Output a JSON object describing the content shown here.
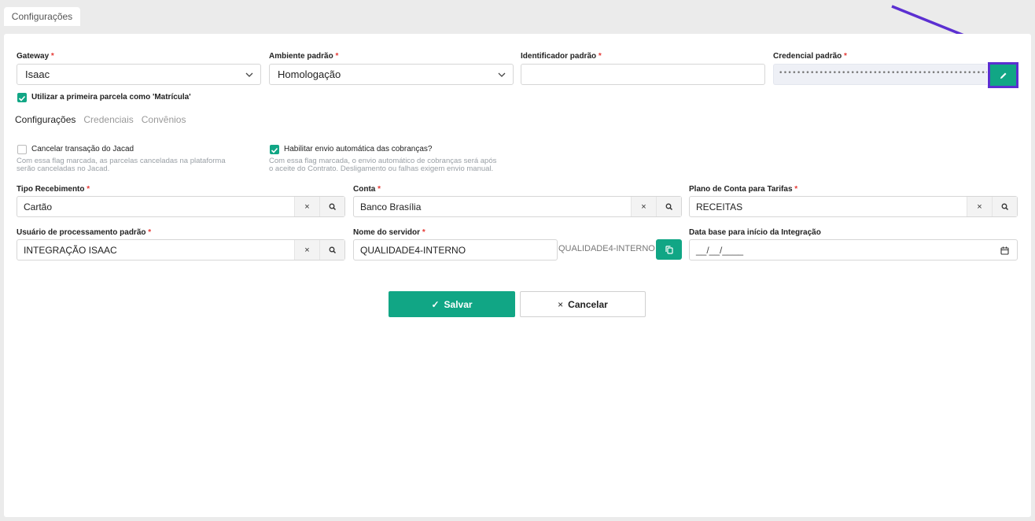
{
  "page_tab": "Configurações",
  "gateway": {
    "label": "Gateway",
    "value": "Isaac"
  },
  "ambiente": {
    "label": "Ambiente padrão",
    "value": "Homologação"
  },
  "identificador": {
    "label": "Identificador padrão",
    "value": ""
  },
  "credencial": {
    "label": "Credencial padrão",
    "masked": "••••••••••••••••••••••••••••••••••••••••••••••••••••••••••••••••••••"
  },
  "required_mark": "*",
  "primeira_parcela": {
    "label": "Utilizar a primeira parcela como 'Matrícula'",
    "checked": true
  },
  "tabs": [
    {
      "label": "Configurações",
      "active": true
    },
    {
      "label": "Credenciais",
      "active": false
    },
    {
      "label": "Convênios",
      "active": false
    }
  ],
  "cancelar_transacao": {
    "label": "Cancelar transação do Jacad",
    "checked": false,
    "hint_line1": "Com essa flag marcada, as parcelas canceladas na plataforma",
    "hint_line2": "serão canceladas no Jacad."
  },
  "habilitar_envio": {
    "label": "Habilitar envio automática das cobranças?",
    "checked": true,
    "hint_line1": "Com essa flag marcada, o envio automático de cobranças será após",
    "hint_line2": "o aceite do Contrato. Desligamento ou falhas exigem envio manual."
  },
  "tipo_recebimento": {
    "label": "Tipo Recebimento",
    "value": "Cartão"
  },
  "conta": {
    "label": "Conta",
    "value": "Banco Brasília"
  },
  "plano_conta": {
    "label": "Plano de Conta para Tarifas",
    "value": "RECEITAS"
  },
  "usuario_processamento": {
    "label": "Usuário de processamento padrão",
    "value": "INTEGRAÇÃO ISAAC"
  },
  "nome_servidor": {
    "label": "Nome do servidor",
    "value": "QUALIDADE4-INTERNO",
    "display": "QUALIDADE4-INTERNO"
  },
  "data_base": {
    "label": "Data base para início da Integração",
    "placeholder": "__/__/____"
  },
  "icons": {
    "clear": "×",
    "search": "search-icon"
  },
  "buttons": {
    "save": "Salvar",
    "save_icon": "✓",
    "cancel": "Cancelar",
    "cancel_icon": "×"
  },
  "colors": {
    "accent": "#11a685",
    "highlight": "#5b2fd1",
    "required": "#e53935"
  }
}
